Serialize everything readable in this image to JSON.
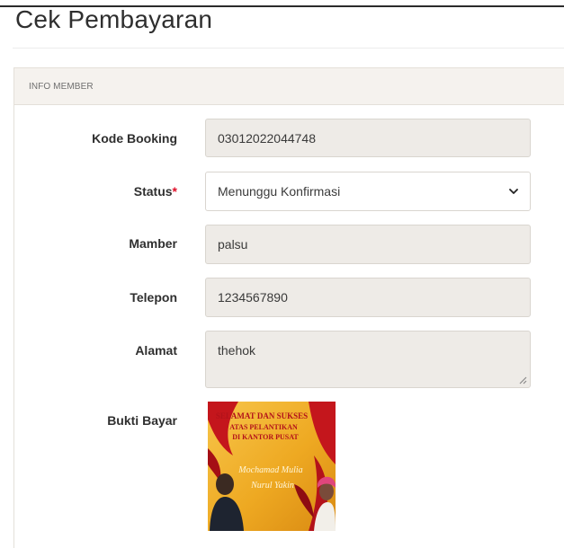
{
  "page": {
    "title": "Cek Pembayaran"
  },
  "card": {
    "header": "INFO MEMBER"
  },
  "form": {
    "kode_booking": {
      "label": "Kode Booking",
      "value": "03012022044748"
    },
    "status": {
      "label": "Status",
      "required_mark": "*",
      "value": "Menunggu Konfirmasi"
    },
    "member": {
      "label": "Mamber",
      "value": "palsu"
    },
    "telepon": {
      "label": "Telepon",
      "value": "1234567890"
    },
    "alamat": {
      "label": "Alamat",
      "value": "thehok"
    },
    "bukti_bayar": {
      "label": "Bukti Bayar",
      "image_text": [
        "SELAMAT DAN SUKSES",
        "ATAS PELANTIKAN",
        "DI KANTOR PUSAT",
        "Mochamad Mulia",
        "Nurul Yakin"
      ]
    }
  },
  "colors": {
    "required": "#e0102a",
    "readonly_field": "#eeebe7",
    "card_header": "#f5f2ee",
    "image_red": "#c4161c",
    "image_gold": "#f0b323"
  },
  "icons": {
    "select": "chevron-down-icon",
    "textarea": "resize-grip-icon"
  }
}
